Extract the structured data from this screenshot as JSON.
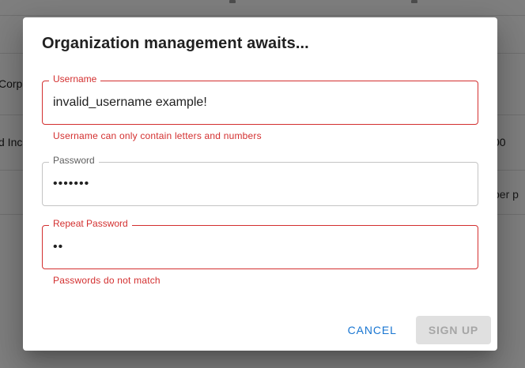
{
  "background": {
    "row1_text": "Corp",
    "row2_text": "d Inc",
    "row2_right_text": "00",
    "footer_text": "per p"
  },
  "dialog": {
    "title": "Organization management awaits...",
    "username": {
      "label": "Username",
      "value": "invalid_username example!",
      "error": "Username can only contain letters and numbers"
    },
    "password": {
      "label": "Password",
      "value": "•••••••"
    },
    "repeat_password": {
      "label": "Repeat Password",
      "value": "••",
      "error": "Passwords do not match"
    },
    "cancel_label": "CANCEL",
    "signup_label": "SIGN UP"
  },
  "colors": {
    "error": "#d32f2f",
    "primary": "#1976d2",
    "disabled_bg": "#e0e0e0",
    "disabled_text": "#a6a6a6"
  }
}
